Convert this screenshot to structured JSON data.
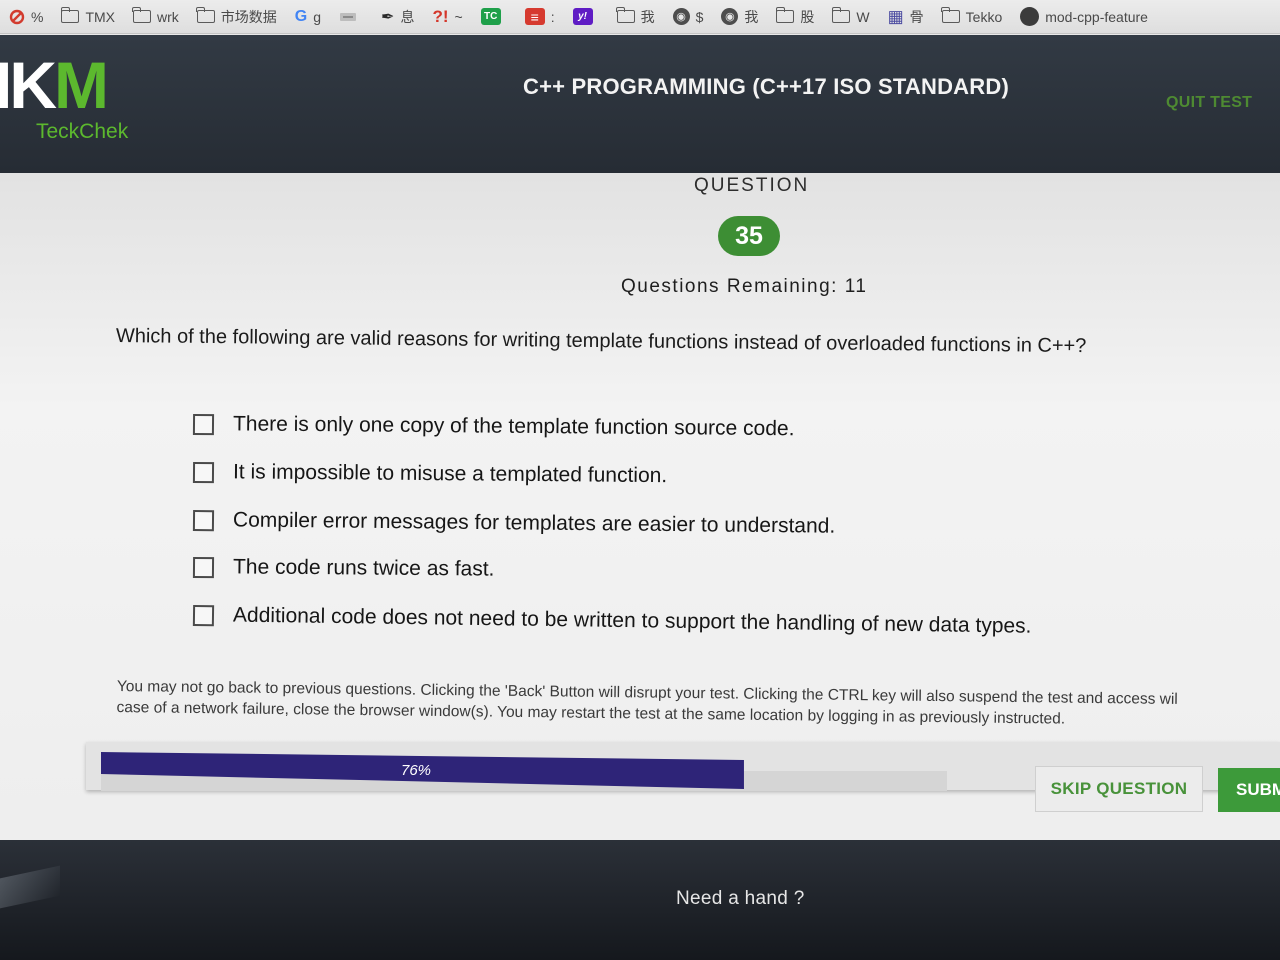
{
  "bookmarks": [
    {
      "label": "%",
      "icon": "blocked-icon"
    },
    {
      "label": "TMX",
      "icon": "folder-icon"
    },
    {
      "label": "wrk",
      "icon": "folder-icon"
    },
    {
      "label": "市场数据",
      "icon": "folder-icon"
    },
    {
      "label": "g",
      "icon": "google-icon",
      "glyph": "G"
    },
    {
      "label": "",
      "icon": "site-favicon"
    },
    {
      "label": "息",
      "icon": "brush-icon",
      "glyph": "✒"
    },
    {
      "label": "~",
      "icon": "question-exclaim-icon",
      "glyph": "?!"
    },
    {
      "label": "",
      "icon": "tc-icon",
      "glyph": "TC"
    },
    {
      "label": ":",
      "icon": "stack-icon",
      "glyph": "≡"
    },
    {
      "label": "",
      "icon": "yahoo-icon",
      "glyph": "y!"
    },
    {
      "label": "我",
      "icon": "folder-icon"
    },
    {
      "label": "$",
      "icon": "globe-icon"
    },
    {
      "label": "我",
      "icon": "globe-icon"
    },
    {
      "label": "股",
      "icon": "folder-icon"
    },
    {
      "label": "W",
      "icon": "folder-icon"
    },
    {
      "label": "骨",
      "icon": "grid-icon",
      "glyph": "▦"
    },
    {
      "label": "Tekko",
      "icon": "folder-icon"
    },
    {
      "label": "mod-cpp-feature",
      "icon": "github-icon"
    }
  ],
  "header": {
    "logo_text": "IK",
    "logo_accent": "M",
    "logo_sub": "TeckChek",
    "title": "C++ PROGRAMMING (C++17 ISO STANDARD)",
    "quit_label": "QUIT TEST"
  },
  "question": {
    "label": "QUESTION",
    "number": "35",
    "remaining": "Questions Remaining: 11",
    "text": "Which of the following are valid reasons for writing template functions instead of overloaded functions in C++?",
    "options": [
      "There is only one copy of the template function source code.",
      "It is impossible to misuse a templated function.",
      "Compiler error messages for templates are easier to understand.",
      "The code runs twice as fast.",
      "Additional code does not need to be written to support the handling of new data types."
    ]
  },
  "notice": {
    "line1": "You may not go back to previous questions. Clicking the 'Back' Button will disrupt your test. Clicking the CTRL key will also suspend the test and access wil",
    "line2": "case of a network failure, close the browser window(s). You may restart the test at the same location by logging in as previously instructed."
  },
  "progress": {
    "label": "76%",
    "fraction": 0.76
  },
  "buttons": {
    "skip": "SKIP QUESTION",
    "submit": "SUBM"
  },
  "footer": {
    "help": "Need a hand ?"
  },
  "colors": {
    "accent_green": "#3d8e34",
    "progress_fill": "#2e2478",
    "header_bg": "#2b323b"
  }
}
